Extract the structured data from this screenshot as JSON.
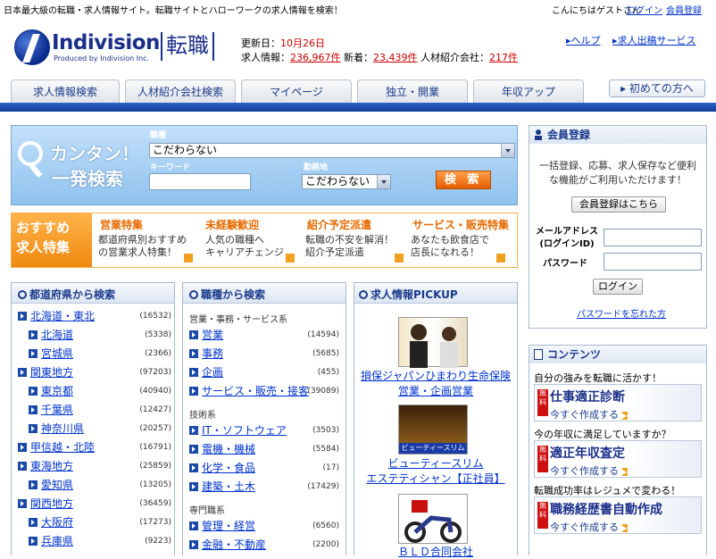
{
  "top": {
    "tagline": "日本最大級の転職・求人情報サイト。転職サイトとハローワークの求人情報を検索！",
    "greeting": "こんにちはゲストさん",
    "login": "ログイン",
    "member_reg": "会員登録"
  },
  "logo": {
    "word": "Indivision",
    "sub": "Produced by Indivision Inc.",
    "kanji": "転職"
  },
  "info": {
    "updated_label": "更新日：",
    "updated_value": "10月26日",
    "jobs_label": "求人情報：",
    "jobs_value": "236,967件",
    "new_label": " 新着：",
    "new_value": "23,439件",
    "agency_label": " 人材紹介会社：",
    "agency_value": "217件"
  },
  "header_links": {
    "help": "ヘルプ",
    "post": "求人出稿サービス"
  },
  "tabs": [
    "求人情報検索",
    "人材紹介会社検索",
    "マイページ",
    "独立・開業",
    "年収アップ"
  ],
  "first_visit": "初めての方へ",
  "search": {
    "catch1": "カンタン！",
    "catch2": "一発検索",
    "job_label": "職種",
    "job_value": "こだわらない",
    "keyword_label": "キーワード",
    "loc_label": "勤務地",
    "loc_value": "こだわらない",
    "button": "検 索"
  },
  "recommend": {
    "title1": "おすすめ",
    "title2": "求人特集",
    "items": [
      {
        "head": "営業特集",
        "l1": "都道府県別おすすめ",
        "l2": "の営業求人特集！"
      },
      {
        "head": "未経験歓迎",
        "l1": "人気の職種へ",
        "l2": "キャリアチェンジ"
      },
      {
        "head": "紹介予定派遣",
        "l1": "転職の不安を解消！",
        "l2": "紹介予定派遣"
      },
      {
        "head": "サービス・販売特集",
        "l1": "あなたも飲食店で",
        "l2": "店長になれる！"
      }
    ]
  },
  "pref": {
    "title": "都道府県から検索",
    "rows": [
      {
        "name": "北海道・東北",
        "count": "(16532)",
        "main": true
      },
      {
        "name": "北海道",
        "count": "(5338)",
        "main": false
      },
      {
        "name": "宮城県",
        "count": "(2366)",
        "main": false
      },
      {
        "name": "関東地方",
        "count": "(97203)",
        "main": true
      },
      {
        "name": "東京都",
        "count": "(40940)",
        "main": false
      },
      {
        "name": "千葉県",
        "count": "(12427)",
        "main": false
      },
      {
        "name": "神奈川県",
        "count": "(20257)",
        "main": false
      },
      {
        "name": "甲信越・北陸",
        "count": "(16791)",
        "main": true
      },
      {
        "name": "東海地方",
        "count": "(25859)",
        "main": true
      },
      {
        "name": "愛知県",
        "count": "(13205)",
        "main": false
      },
      {
        "name": "関西地方",
        "count": "(36459)",
        "main": true
      },
      {
        "name": "大阪府",
        "count": "(17273)",
        "main": false
      },
      {
        "name": "兵庫県",
        "count": "(9223)",
        "main": false
      }
    ]
  },
  "jobs": {
    "title": "職種から検索",
    "groups": [
      {
        "label": "営業・事務・サービス系"
      },
      {
        "label": "技術系"
      },
      {
        "label": "専門職系"
      }
    ],
    "rows": [
      {
        "name": "営業",
        "count": "(14594)"
      },
      {
        "name": "事務",
        "count": "(5685)"
      },
      {
        "name": "企画",
        "count": "(455)"
      },
      {
        "name": "サービス・販売・接客",
        "count": "(39089)"
      },
      {
        "name": "IT・ソフトウェア",
        "count": "(3503)"
      },
      {
        "name": "電機・機械",
        "count": "(5584)"
      },
      {
        "name": "化学・食品",
        "count": "(17)"
      },
      {
        "name": "建築・土木",
        "count": "(17429)"
      },
      {
        "name": "管理・経営",
        "count": "(6560)"
      },
      {
        "name": "金融・不動産",
        "count": "(2200)"
      }
    ]
  },
  "pickup": {
    "title": "求人情報PICKUP",
    "items": [
      {
        "l1": "損保ジャパンひまわり生命保険",
        "l2": "営業・企画営業"
      },
      {
        "l1": "ビューティースリム",
        "l2": "エステティシャン【正社員】",
        "img_text": "ビューティースリム"
      },
      {
        "l1": "ＢＬＤ合同会社",
        "l2": ""
      }
    ]
  },
  "member": {
    "title": "会員登録",
    "text": "一括登録、応募、求人保存など便利な機能がご利用いただけます！",
    "reg_button": "会員登録はこちら",
    "mail_label1": "メールアドレス",
    "mail_label2": "(ログインID)",
    "pw_label": "パスワード",
    "login_button": "ログイン",
    "forgot": "パスワードを忘れた方"
  },
  "contents": {
    "title": "コンテンツ",
    "items": [
      {
        "lead": "自分の強みを転職に活かす！",
        "badge": "無料",
        "title": "仕事適正診断",
        "sub": "今すぐ作成する"
      },
      {
        "lead": "今の年収に満足していますか？",
        "badge": "無料",
        "title": "適正年収査定",
        "sub": "今すぐ作成する"
      },
      {
        "lead": "転職成功率はレジュメで変わる！",
        "badge": "無料",
        "title": "職務経歴書自動作成",
        "sub": "今すぐ作成する"
      }
    ]
  },
  "colors": {
    "accent": "#1a3a8c",
    "nav": "#123f9a",
    "red": "#cc0000",
    "orange": "#e66a00"
  }
}
